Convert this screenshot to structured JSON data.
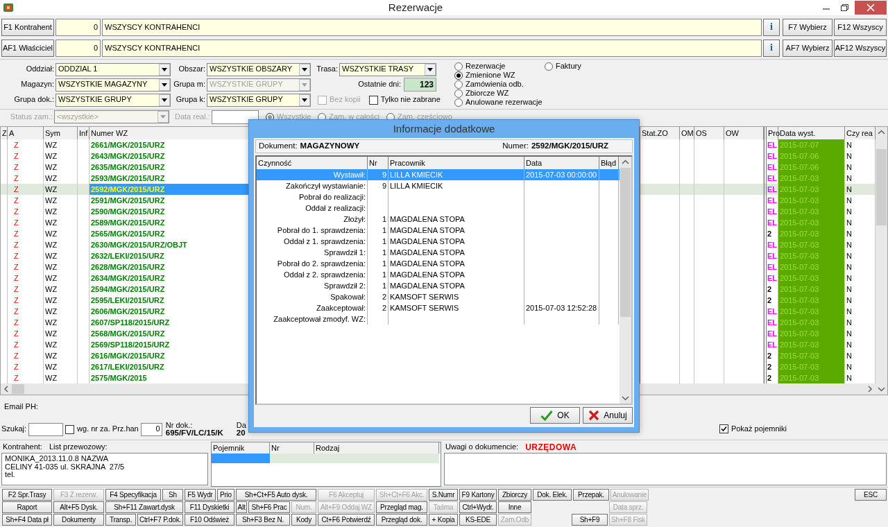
{
  "window": {
    "title": "Rezerwacje"
  },
  "pick_rows": [
    {
      "button": "F1 Kontrahent",
      "code": "0",
      "name": "WSZYSCY KONTRAHENCI",
      "info": "i",
      "buttons": [
        "F7 Wybierz",
        "F12 Wszyscy"
      ]
    },
    {
      "button": "AF1 Właściciel",
      "code": "0",
      "name": "WSZYSCY KONTRAHENCI",
      "info": "i",
      "buttons": [
        "AF7 Wybierz",
        "AF12 Wszyscy"
      ]
    }
  ],
  "filters": {
    "combos": [
      {
        "label": "Oddział:",
        "value": "ODDZIAL 1",
        "disabled": false
      },
      {
        "label": "Obszar:",
        "value": "WSZYSTKIE OBSZARY",
        "disabled": false
      },
      {
        "label": "Trasa:",
        "value": "WSZYSTKIE TRASY",
        "disabled": false
      },
      {
        "label": "Magazyn:",
        "value": "WSZYSTKIE MAGAZYNY",
        "disabled": false
      },
      {
        "label": "Grupa m:",
        "value": "WSZYSTKIE GRUPY",
        "disabled": true
      },
      {
        "label": "Grupa dok.:",
        "value": "WSZYSTKIE GRUPY",
        "disabled": false
      },
      {
        "label": "Grupa k:",
        "value": "WSZYSTKIE GRUPY",
        "disabled": false
      }
    ],
    "days": {
      "label": "Ostatnie dni:",
      "value": "123"
    },
    "checkboxes": [
      {
        "label": "Bez kopii",
        "checked": false,
        "disabled": true
      },
      {
        "label": "Tylko nie zabrane",
        "checked": false,
        "disabled": false
      }
    ],
    "radios": [
      {
        "label": "Rezerwacje",
        "selected": false
      },
      {
        "label": "Zmienione WZ",
        "selected": true
      },
      {
        "label": "Zamówienia odb.",
        "selected": false
      },
      {
        "label": "Zbiorcze WZ",
        "selected": false
      },
      {
        "label": "Anulowane rezerwacje",
        "selected": false
      },
      {
        "label": "Faktury",
        "selected": false
      }
    ]
  },
  "status": {
    "label": "Status zam.:",
    "value": "<wszystkie>",
    "disabled": true,
    "date_label": "Data real.:",
    "radios": [
      {
        "label": "Wszystkie",
        "selected": true
      },
      {
        "label": "Zam. w całości",
        "selected": false
      },
      {
        "label": "Zam. częściowo",
        "selected": false
      }
    ]
  },
  "grid": {
    "columns_left": [
      "Z",
      "A",
      "Sym",
      "Inf",
      "Numer WZ"
    ],
    "columns_right": [
      "Stat.ZO",
      "OM",
      "OS",
      "OW",
      "Pro",
      "Data wyst.",
      "Czy rea"
    ],
    "rows": [
      {
        "a": "Z",
        "sym": "WZ",
        "number": "2661/MGK/2015/URZ",
        "pro": {
          "text": "EL",
          "color": "#ff00ff"
        },
        "date": "2015-07-07",
        "czy": "N",
        "selected": false
      },
      {
        "a": "Z",
        "sym": "WZ",
        "number": "2643/MGK/2015/URZ",
        "pro": {
          "text": "EL",
          "color": "#ff00ff"
        },
        "date": "2015-07-06",
        "czy": "N",
        "selected": false
      },
      {
        "a": "Z",
        "sym": "WZ",
        "number": "2635/MGK/2015/URZ",
        "pro": {
          "text": "EL",
          "color": "#ff00ff"
        },
        "date": "2015-07-06",
        "czy": "N",
        "selected": false
      },
      {
        "a": "Z",
        "sym": "WZ",
        "number": "2593/MGK/2015/URZ",
        "pro": {
          "text": "EL",
          "color": "#ff00ff"
        },
        "date": "2015-07-03",
        "czy": "N",
        "selected": false
      },
      {
        "a": "Z",
        "sym": "WZ",
        "number": "2592/MGK/2015/URZ",
        "pro": {
          "text": "EL",
          "color": "#ff00ff"
        },
        "date": "2015-07-03",
        "czy": "N",
        "selected": true
      },
      {
        "a": "Z",
        "sym": "WZ",
        "number": "2591/MGK/2015/URZ",
        "pro": {
          "text": "EL",
          "color": "#ff00ff"
        },
        "date": "2015-07-03",
        "czy": "N",
        "selected": false
      },
      {
        "a": "Z",
        "sym": "WZ",
        "number": "2590/MGK/2015/URZ",
        "pro": {
          "text": "EL",
          "color": "#ff00ff"
        },
        "date": "2015-07-03",
        "czy": "N",
        "selected": false
      },
      {
        "a": "Z",
        "sym": "WZ",
        "number": "2589/MGK/2015/URZ",
        "pro": {
          "text": "EL",
          "color": "#ff00ff"
        },
        "date": "2015-07-03",
        "czy": "N",
        "selected": false
      },
      {
        "a": "Z",
        "sym": "WZ",
        "number": "2565/MGK/2015/URZ",
        "pro": {
          "text": "2",
          "color": "#000000"
        },
        "date": "2015-07-03",
        "czy": "N",
        "selected": false
      },
      {
        "a": "Z",
        "sym": "WZ",
        "number": "2630/MGK/2015/URZ/OBJT",
        "pro": {
          "text": "EL",
          "color": "#ff00ff"
        },
        "date": "2015-07-03",
        "czy": "N",
        "selected": false
      },
      {
        "a": "Z",
        "sym": "WZ",
        "number": "2632/LEKI/2015/URZ",
        "pro": {
          "text": "EL",
          "color": "#ff00ff"
        },
        "date": "2015-07-03",
        "czy": "N",
        "selected": false
      },
      {
        "a": "Z",
        "sym": "WZ",
        "number": "2628/MGK/2015/URZ",
        "pro": {
          "text": "EL",
          "color": "#ff00ff"
        },
        "date": "2015-07-03",
        "czy": "N",
        "selected": false
      },
      {
        "a": "Z",
        "sym": "WZ",
        "number": "2634/MGK/2015/URZ",
        "pro": {
          "text": "EL",
          "color": "#ff00ff"
        },
        "date": "2015-07-03",
        "czy": "N",
        "selected": false
      },
      {
        "a": "Z",
        "sym": "WZ",
        "number": "2594/MGK/2015/URZ",
        "pro": {
          "text": "2",
          "color": "#000000"
        },
        "date": "2015-07-03",
        "czy": "N",
        "selected": false
      },
      {
        "a": "Z",
        "sym": "WZ",
        "number": "2595/LEKI/2015/URZ",
        "pro": {
          "text": "2",
          "color": "#000000"
        },
        "date": "2015-07-03",
        "czy": "N",
        "selected": false
      },
      {
        "a": "Z",
        "sym": "WZ",
        "number": "2606/MGK/2015/URZ",
        "pro": {
          "text": "EL",
          "color": "#ff00ff"
        },
        "date": "2015-07-03",
        "czy": "N",
        "selected": false
      },
      {
        "a": "Z",
        "sym": "WZ",
        "number": "2607/SP118/2015/URZ",
        "pro": {
          "text": "EL",
          "color": "#ff00ff"
        },
        "date": "2015-07-03",
        "czy": "N",
        "selected": false
      },
      {
        "a": "Z",
        "sym": "WZ",
        "number": "2568/MGK/2015/URZ",
        "pro": {
          "text": "EL",
          "color": "#ff00ff"
        },
        "date": "2015-07-03",
        "czy": "N",
        "selected": false
      },
      {
        "a": "Z",
        "sym": "WZ",
        "number": "2569/SP118/2015/URZ",
        "pro": {
          "text": "EL",
          "color": "#ff00ff"
        },
        "date": "2015-07-03",
        "czy": "N",
        "selected": false
      },
      {
        "a": "Z",
        "sym": "WZ",
        "number": "2616/MGK/2015/URZ",
        "pro": {
          "text": "2",
          "color": "#000000"
        },
        "date": "2015-07-03",
        "czy": "N",
        "selected": false
      },
      {
        "a": "Z",
        "sym": "WZ",
        "number": "2617/LEKI/2015/URZ",
        "pro": {
          "text": "2",
          "color": "#000000"
        },
        "date": "2015-07-03",
        "czy": "N",
        "selected": false
      },
      {
        "a": "Z",
        "sym": "WZ",
        "number": "2575/MGK/2015",
        "pro": {
          "text": "2",
          "color": "#000000"
        },
        "date": "2015-07-03",
        "czy": "N",
        "selected": false
      }
    ]
  },
  "email_label": "Email PH:",
  "search": {
    "label": "Szukaj:",
    "checkbox": {
      "label": "wg. nr za. Prz.han",
      "checked": false
    },
    "counter": "0",
    "doc_label": "Nr dok.:",
    "doc_value": "695/FV/LC/15/K",
    "date_label": "Da",
    "date_value": "20",
    "show_containers": {
      "label": "Pokaż pojemniki",
      "checked": true
    }
  },
  "contractor": {
    "label": "Kontrahent:",
    "waybill_label": "List przewozowy:",
    "lines": [
      "MONIKA_2013.11.0.8 NAZWA",
      "CELINY 41-035 ul. SKRAJNA  27/5",
      "tel."
    ]
  },
  "containers": {
    "columns": [
      "Pojemnik",
      "Nr",
      "Rodzaj"
    ]
  },
  "notes": {
    "label": "Uwagi o dokumencie:",
    "value": "URZĘDOWA"
  },
  "button_rows": [
    [
      {
        "label": "F2 Spr.Trasy",
        "disabled": false
      },
      {
        "label": "F3 Z rezerw.",
        "disabled": true
      },
      {
        "label": "F4 Specyfikacja",
        "disabled": false
      },
      {
        "label": "Sh",
        "disabled": false
      },
      {
        "label": "F5 Wydr",
        "disabled": false
      },
      {
        "label": "Prio",
        "disabled": false
      },
      {
        "label": "Sh+Ct+F5 Auto dysk.",
        "disabled": false
      },
      {
        "label": "F6 Akceptuj",
        "disabled": true
      },
      {
        "label": "Sh+Ct+F6 Akc.",
        "disabled": true
      },
      {
        "label": "S.Numr",
        "disabled": false
      },
      {
        "label": "F9 Kartony",
        "disabled": false
      },
      {
        "label": "Zbiorczy",
        "disabled": false
      },
      {
        "label": "Dok. Elek.",
        "disabled": false
      },
      {
        "label": "Przepak.",
        "disabled": false
      },
      {
        "label": "Anulowanie",
        "disabled": true
      },
      {
        "label": "ESC",
        "disabled": false
      }
    ],
    [
      {
        "label": "Raport",
        "disabled": false
      },
      {
        "label": "Alt+F5 Dysk.",
        "disabled": false
      },
      {
        "label": "Sh+F11 Zawart.dysk",
        "disabled": false
      },
      {
        "label": "F11 Dyskietki",
        "disabled": false
      },
      {
        "label": "Alt",
        "disabled": false
      },
      {
        "label": "Sh+F6 Prac",
        "disabled": false
      },
      {
        "label": "Num.",
        "disabled": true
      },
      {
        "label": "Alt+F9 Oddaj WZ",
        "disabled": true
      },
      {
        "label": "Przegląd mag.",
        "disabled": false
      },
      {
        "label": "Taśma",
        "disabled": true
      },
      {
        "label": "Ctrl+Wydr.",
        "disabled": false
      },
      {
        "label": "Inne",
        "disabled": false
      },
      {
        "label": "Data sprz.",
        "disabled": true
      }
    ],
    [
      {
        "label": "Sh+F4 Data pł",
        "disabled": false
      },
      {
        "label": "Dokumenty",
        "disabled": false
      },
      {
        "label": "Transp.",
        "disabled": false
      },
      {
        "label": "Ctrl+F7 P.dok.",
        "disabled": false
      },
      {
        "label": "F10 Odśwież",
        "disabled": false
      },
      {
        "label": "Sh+F3 Bez N.",
        "disabled": false
      },
      {
        "label": "Kody",
        "disabled": false
      },
      {
        "label": "Ct+F6 Potwierdź",
        "disabled": false
      },
      {
        "label": "Przegląd dok.",
        "disabled": false
      },
      {
        "label": "+ Kopia",
        "disabled": false
      },
      {
        "label": "KS-EDE",
        "disabled": false
      },
      {
        "label": "Zam.Odb",
        "disabled": true
      },
      {
        "label": "Sh+F9",
        "disabled": false
      },
      {
        "label": "Sh+F8 Fisk",
        "disabled": true
      }
    ]
  ],
  "dialog": {
    "title": "Informacje dodatkowe",
    "document_label": "Dokument:",
    "document": "MAGAZYNOWY",
    "number_label": "Numer:",
    "number": "2592/MGK/2015/URZ",
    "columns": [
      "Czynność",
      "Nr",
      "Pracownik",
      "Data",
      "Błąd"
    ],
    "rows": [
      {
        "activity": "Wystawił:",
        "nr": "9",
        "worker": "LILLA KMIECIK",
        "date": "2015-07-03 00:00:00",
        "selected": true
      },
      {
        "activity": "Zakończył wystawianie:",
        "nr": "9",
        "worker": "LILLA KMIECIK",
        "date": "",
        "selected": false
      },
      {
        "activity": "Pobrał do realizacji:",
        "nr": "",
        "worker": "",
        "date": "",
        "selected": false
      },
      {
        "activity": "Oddał z realizacji:",
        "nr": "",
        "worker": "",
        "date": "",
        "selected": false
      },
      {
        "activity": "Złożył:",
        "nr": "1",
        "worker": "MAGDALENA STOPA",
        "date": "",
        "selected": false
      },
      {
        "activity": "Pobrał do 1. sprawdzenia:",
        "nr": "1",
        "worker": "MAGDALENA STOPA",
        "date": "",
        "selected": false
      },
      {
        "activity": "Oddał z 1. sprawdzenia:",
        "nr": "1",
        "worker": "MAGDALENA STOPA",
        "date": "",
        "selected": false
      },
      {
        "activity": "Sprawdził 1:",
        "nr": "1",
        "worker": "MAGDALENA STOPA",
        "date": "",
        "selected": false
      },
      {
        "activity": "Pobrał do 2. sprawdzenia:",
        "nr": "1",
        "worker": "MAGDALENA STOPA",
        "date": "",
        "selected": false
      },
      {
        "activity": "Oddał z 2. sprawdzenia:",
        "nr": "1",
        "worker": "MAGDALENA STOPA",
        "date": "",
        "selected": false
      },
      {
        "activity": "Sprawdził 2:",
        "nr": "1",
        "worker": "MAGDALENA STOPA",
        "date": "",
        "selected": false
      },
      {
        "activity": "Spakował:",
        "nr": "2",
        "worker": "KAMSOFT SERWIS",
        "date": "",
        "selected": false
      },
      {
        "activity": "Zaakceptował:",
        "nr": "2",
        "worker": "KAMSOFT SERWIS",
        "date": "2015-07-03 12:52:28",
        "selected": false
      },
      {
        "activity": "Zaakceptował zmodyf. WZ:",
        "nr": "",
        "worker": "",
        "date": "",
        "selected": false
      }
    ],
    "buttons": [
      {
        "label": "OK",
        "kind": "ok"
      },
      {
        "label": "Anuluj",
        "kind": "cancel"
      }
    ]
  }
}
